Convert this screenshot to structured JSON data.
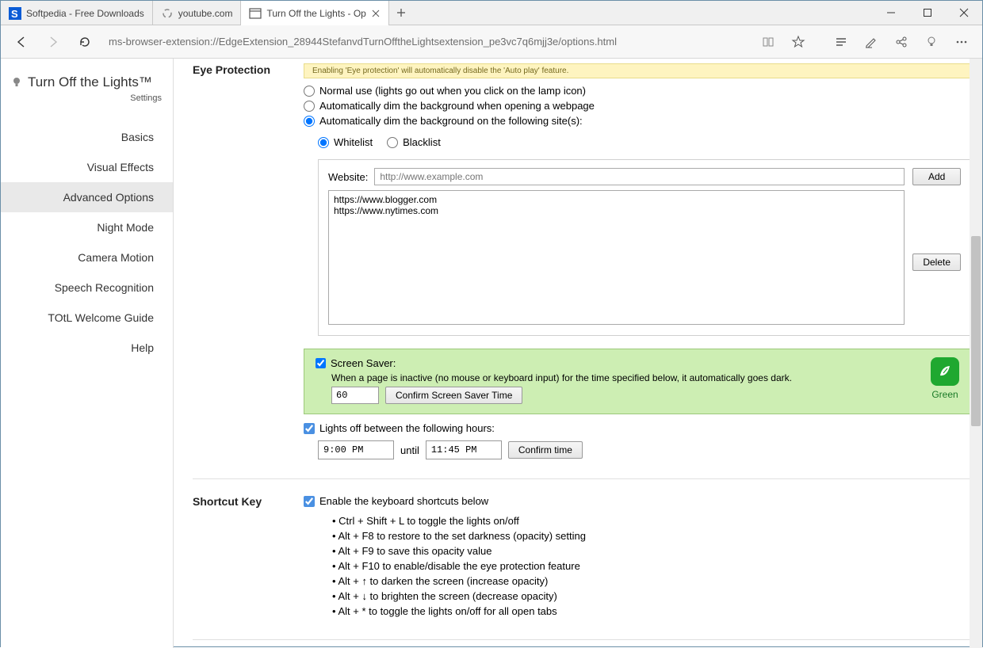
{
  "tabs": [
    {
      "title": "Softpedia - Free Downloads"
    },
    {
      "title": "youtube.com"
    },
    {
      "title": "Turn Off the Lights - Op"
    }
  ],
  "url": "ms-browser-extension://EdgeExtension_28944StefanvdTurnOfftheLightsextension_pe3vc7q6mjj3e/options.html",
  "brand": {
    "title": "Turn Off the Lights™",
    "sub": "Settings"
  },
  "nav": [
    "Basics",
    "Visual Effects",
    "Advanced Options",
    "Night Mode",
    "Camera Motion",
    "Speech Recognition",
    "TOtL Welcome Guide",
    "Help"
  ],
  "eye": {
    "heading": "Eye Protection",
    "banner": "Enabling 'Eye protection' will automatically disable the 'Auto play' feature.",
    "opt_normal": "Normal use (lights go out when you click on the lamp icon)",
    "opt_auto_open": "Automatically dim the background when opening a webpage",
    "opt_auto_sites": "Automatically dim the background on the following site(s):",
    "whitelist": "Whitelist",
    "blacklist": "Blacklist",
    "website_label": "Website:",
    "website_placeholder": "http://www.example.com",
    "add": "Add",
    "delete": "Delete",
    "sites": "https://www.blogger.com\nhttps://www.nytimes.com"
  },
  "screensaver": {
    "title": "Screen Saver:",
    "desc": "When a page is inactive (no mouse or keyboard input) for the time specified below, it automatically goes dark.",
    "value": "60",
    "confirm": "Confirm Screen Saver Time",
    "badge": "Green"
  },
  "hours": {
    "label": "Lights off between the following hours:",
    "from": "9:00 PM",
    "until_label": "until",
    "to": "11:45 PM",
    "confirm": "Confirm time"
  },
  "shortcut": {
    "heading": "Shortcut Key",
    "enable": "Enable the keyboard shortcuts below",
    "list": [
      "Ctrl + Shift + L to toggle the lights on/off",
      "Alt + F8 to restore to the set darkness (opacity) setting",
      "Alt + F9 to save this opacity value",
      "Alt + F10 to enable/disable the eye protection feature",
      "Alt + ↑ to darken the screen (increase opacity)",
      "Alt + ↓ to brighten the screen (decrease opacity)",
      "Alt + * to toggle the lights on/off for all open tabs"
    ]
  }
}
